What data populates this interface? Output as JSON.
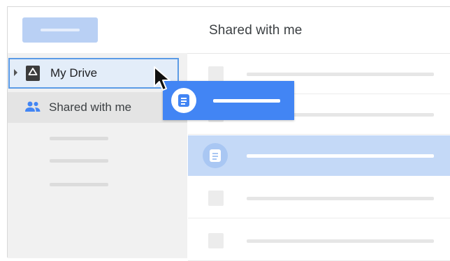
{
  "header": {
    "title": "Shared with me"
  },
  "sidebar": {
    "items": [
      {
        "label": "My Drive",
        "icon": "drive-icon",
        "selected": true
      },
      {
        "label": "Shared with me",
        "icon": "people-icon",
        "selected": false
      }
    ]
  },
  "list": {
    "row_count": 5,
    "selected_row": 2
  },
  "drag_item": {
    "icon": "document-icon"
  },
  "colors": {
    "accent": "#4285f4",
    "selected_row": "#c4d9f7",
    "drop_target_border": "#5b9be6",
    "sidebar_bg": "#f1f1f1"
  }
}
